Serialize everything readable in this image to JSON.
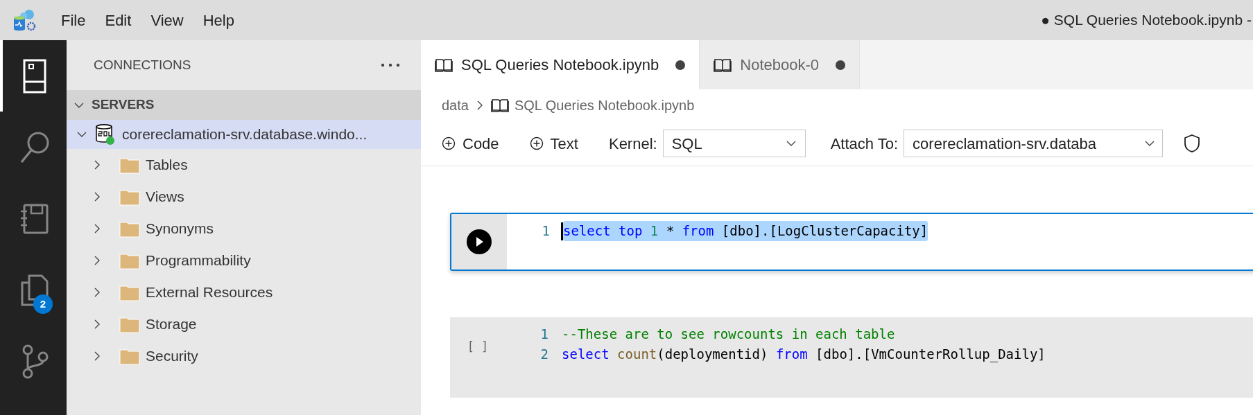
{
  "menu": [
    "File",
    "Edit",
    "View",
    "Help"
  ],
  "window_title": "● SQL Queries Notebook.ipynb -",
  "activity_bar": [
    {
      "kind": "explorer",
      "selected": true
    },
    {
      "kind": "search",
      "selected": false
    },
    {
      "kind": "notebook",
      "selected": false
    },
    {
      "kind": "files",
      "selected": false,
      "badge": "2"
    },
    {
      "kind": "branch",
      "selected": false
    }
  ],
  "sidebar": {
    "title": "CONNECTIONS",
    "section": {
      "label": "SERVERS",
      "expanded": true
    },
    "server": {
      "label": "corereclamation-srv.database.windo...",
      "expanded": true,
      "connected": true,
      "selected": true
    },
    "folders": [
      {
        "label": "Tables",
        "expanded": false
      },
      {
        "label": "Views",
        "expanded": false
      },
      {
        "label": "Synonyms",
        "expanded": false
      },
      {
        "label": "Programmability",
        "expanded": false
      },
      {
        "label": "External Resources",
        "expanded": false
      },
      {
        "label": "Storage",
        "expanded": false
      },
      {
        "label": "Security",
        "expanded": false
      }
    ]
  },
  "tabs": [
    {
      "label": "SQL Queries Notebook.ipynb",
      "selected": true,
      "dirty": true
    },
    {
      "label": "Notebook-0",
      "selected": false,
      "dirty": true
    }
  ],
  "breadcrumb": [
    "data",
    "SQL Queries Notebook.ipynb"
  ],
  "toolbar": {
    "add_code": "Code",
    "add_text": "Text",
    "kernel": {
      "label": "Kernel:",
      "value": "SQL"
    },
    "attach": {
      "label": "Attach To:",
      "value": "corereclamation-srv.databa"
    }
  },
  "cells": [
    {
      "selected": true,
      "lines": [
        {
          "number": "1",
          "selected": true,
          "cursor": true,
          "tokens": [
            {
              "kind": "keyword",
              "text": "select "
            },
            {
              "kind": "keyword",
              "text": "top "
            },
            {
              "kind": "number",
              "text": "1"
            },
            {
              "kind": "plain",
              "text": " * "
            },
            {
              "kind": "keyword",
              "text": "from"
            },
            {
              "kind": "plain",
              "text": " [dbo].[LogClusterCapacity]"
            }
          ]
        }
      ]
    },
    {
      "selected": false,
      "execution_label": "[ ]",
      "lines": [
        {
          "number": "1",
          "selected": false,
          "cursor": false,
          "tokens": [
            {
              "kind": "comment",
              "text": "--These are to see rowcounts in each table"
            }
          ]
        },
        {
          "number": "2",
          "selected": false,
          "cursor": false,
          "tokens": [
            {
              "kind": "keyword",
              "text": "select "
            },
            {
              "kind": "function",
              "text": "count"
            },
            {
              "kind": "plain",
              "text": "(deploymentid) "
            },
            {
              "kind": "keyword",
              "text": "from"
            },
            {
              "kind": "plain",
              "text": " [dbo].[VmCounterRollup_Daily]"
            }
          ]
        }
      ]
    }
  ]
}
